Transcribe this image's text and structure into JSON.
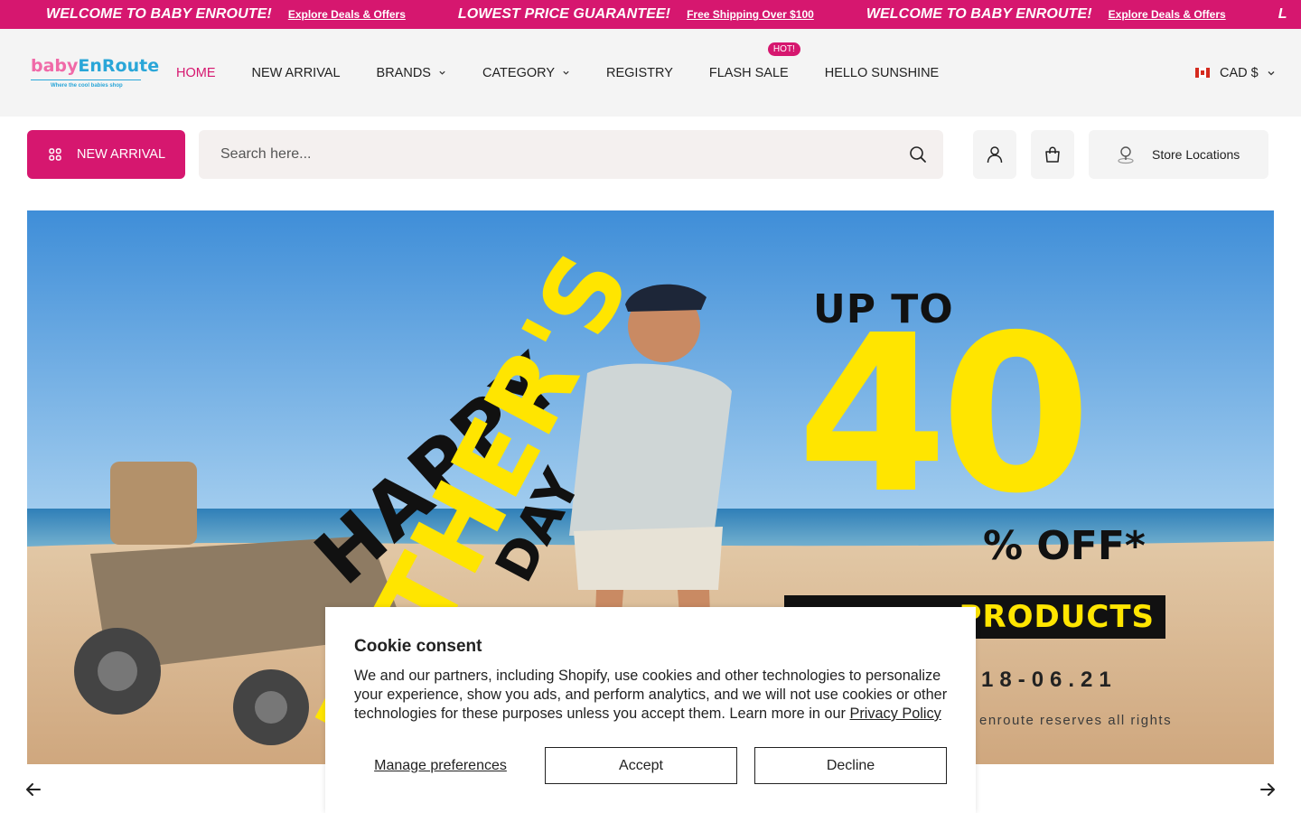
{
  "announcement": {
    "items": [
      {
        "headline": "WELCOME TO BABY ENROUTE!",
        "link": "Explore Deals & Offers"
      },
      {
        "headline": "LOWEST PRICE GUARANTEE!",
        "link": "Free Shipping Over $100"
      },
      {
        "headline": "WELCOME TO BABY ENROUTE!",
        "link": "Explore Deals & Offers"
      },
      {
        "headline": "L",
        "link": ""
      }
    ]
  },
  "logo": {
    "part1": "baby",
    "part2": "EnRoute",
    "tagline": "Where the cool babies shop"
  },
  "nav": {
    "items": [
      {
        "label": "HOME"
      },
      {
        "label": "NEW ARRIVAL"
      },
      {
        "label": "BRANDS"
      },
      {
        "label": "CATEGORY"
      },
      {
        "label": "REGISTRY"
      },
      {
        "label": "FLASH SALE",
        "badge": "Hot!"
      },
      {
        "label": "HELLO SUNSHINE"
      }
    ]
  },
  "currency": {
    "label": "CAD $"
  },
  "category_button": {
    "label": "NEW ARRIVAL"
  },
  "search": {
    "placeholder": "Search here..."
  },
  "store_locations": {
    "label": "Store Locations"
  },
  "hero": {
    "happy": "HAPPY",
    "fathers": "FATHER'S",
    "day": "DAY",
    "up_to": "UP TO",
    "percent": "40",
    "off": "% OFF*",
    "selected": "PRODUCTS",
    "date": "18-06.21",
    "rights": "enroute reserves all rights"
  },
  "cookie": {
    "title": "Cookie consent",
    "body": "We and our partners, including Shopify, use cookies and other technologies to personalize your experience, show you ads, and perform analytics, and we will not use cookies or other technologies for these purposes unless you accept them. Learn more in our ",
    "policy_link": "Privacy Policy",
    "manage": "Manage preferences",
    "accept": "Accept",
    "decline": "Decline"
  },
  "colors": {
    "brand_pink": "#d6176f",
    "hero_yellow": "#ffe500"
  }
}
